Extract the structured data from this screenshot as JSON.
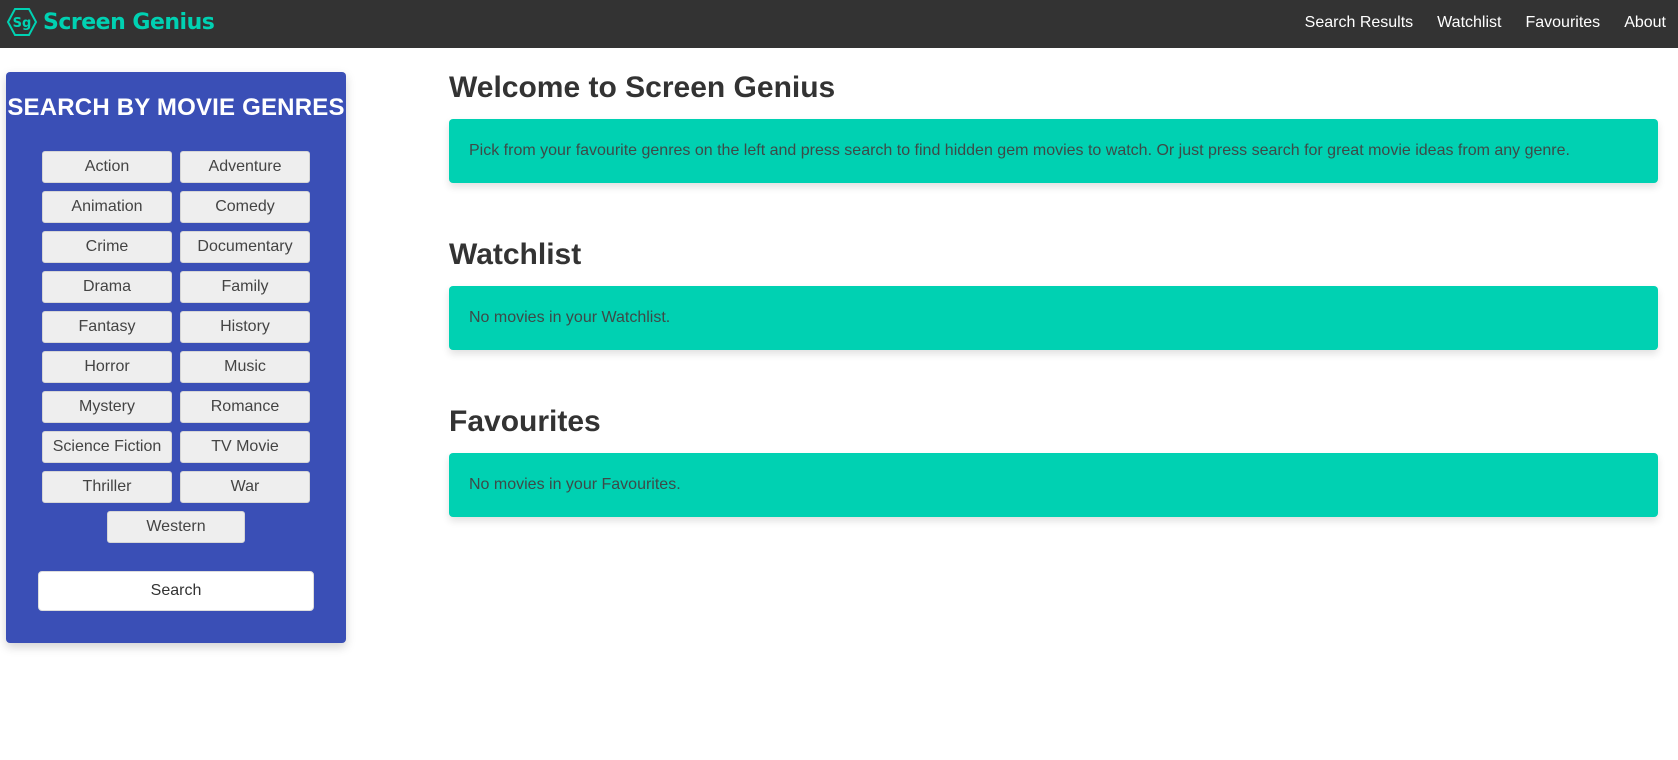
{
  "nav": {
    "brand_logo_text": "Sg",
    "brand_name": "Screen Genius",
    "links": [
      "Search Results",
      "Watchlist",
      "Favourites",
      "About"
    ]
  },
  "sidebar": {
    "title": "SEARCH BY MOVIE GENRES",
    "genres": [
      "Action",
      "Adventure",
      "Animation",
      "Comedy",
      "Crime",
      "Documentary",
      "Drama",
      "Family",
      "Fantasy",
      "History",
      "Horror",
      "Music",
      "Mystery",
      "Romance",
      "Science Fiction",
      "TV Movie",
      "Thriller",
      "War",
      "Western"
    ],
    "search_label": "Search"
  },
  "main": {
    "welcome_title": "Welcome to Screen Genius",
    "welcome_text": "Pick from your favourite genres on the left and press search to find hidden gem movies to watch. Or just press search for great movie ideas from any genre.",
    "watchlist_title": "Watchlist",
    "watchlist_text": "No movies in your Watchlist.",
    "favourites_title": "Favourites",
    "favourites_text": "No movies in your Favourites."
  },
  "colors": {
    "navbar": "#333333",
    "brand": "#00d1b2",
    "panel": "#3a4fb6",
    "notice": "#00d1b2"
  }
}
